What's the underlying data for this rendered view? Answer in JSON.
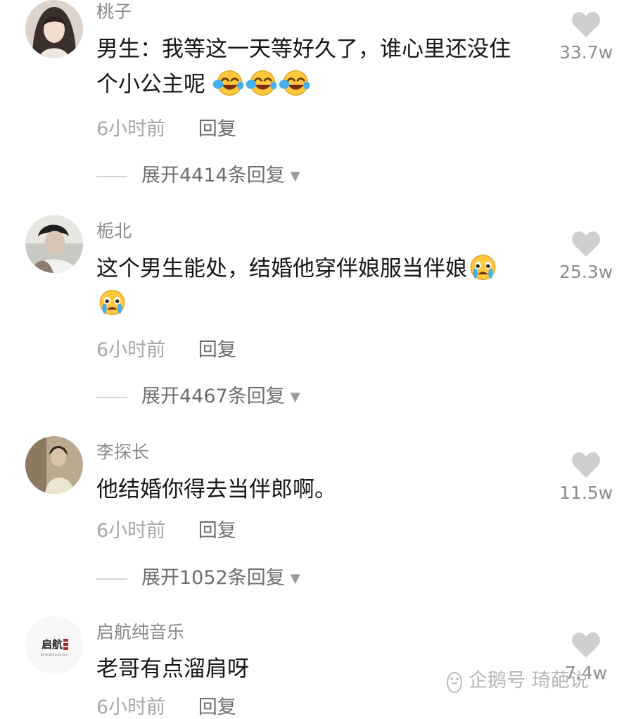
{
  "comments": [
    {
      "username": "桃子",
      "text_line1": "男生：我等这一天等好久了，谁心里还没住",
      "text_line2": "个小公主呢",
      "time": "6小时前",
      "reply_label": "回复",
      "expand_label": "展开4414条回复",
      "like_count": "33.7w"
    },
    {
      "username": "栀北",
      "text_line1": "这个男生能处，结婚他穿伴娘服当伴娘",
      "time": "6小时前",
      "reply_label": "回复",
      "expand_label": "展开4467条回复",
      "like_count": "25.3w"
    },
    {
      "username": "李探长",
      "text_line1": "他结婚你得去当伴郎啊。",
      "time": "6小时前",
      "reply_label": "回复",
      "expand_label": "展开1052条回复",
      "like_count": "11.5w"
    },
    {
      "username": "启航纯音乐",
      "avatar_logo_text": "启航",
      "avatar_logo_subtext": "QihangChunyinyue",
      "text_line1": "老哥有点溜肩呀",
      "time": "6小时前",
      "reply_label": "回复",
      "like_count": "7.4w"
    }
  ],
  "watermark": {
    "text": "企鹅号 琦葩说"
  },
  "icons": {
    "like": "heart-icon",
    "expand": "caret-down-icon",
    "emoji_laugh_cry": "laughing-crying-emoji-icon",
    "emoji_crying": "crying-emoji-icon"
  },
  "colors": {
    "username": "#8a8a8a",
    "body_text": "#161616",
    "time": "#a8a8a8",
    "reply": "#6e6e6e",
    "heart": "#cfcfcf"
  }
}
